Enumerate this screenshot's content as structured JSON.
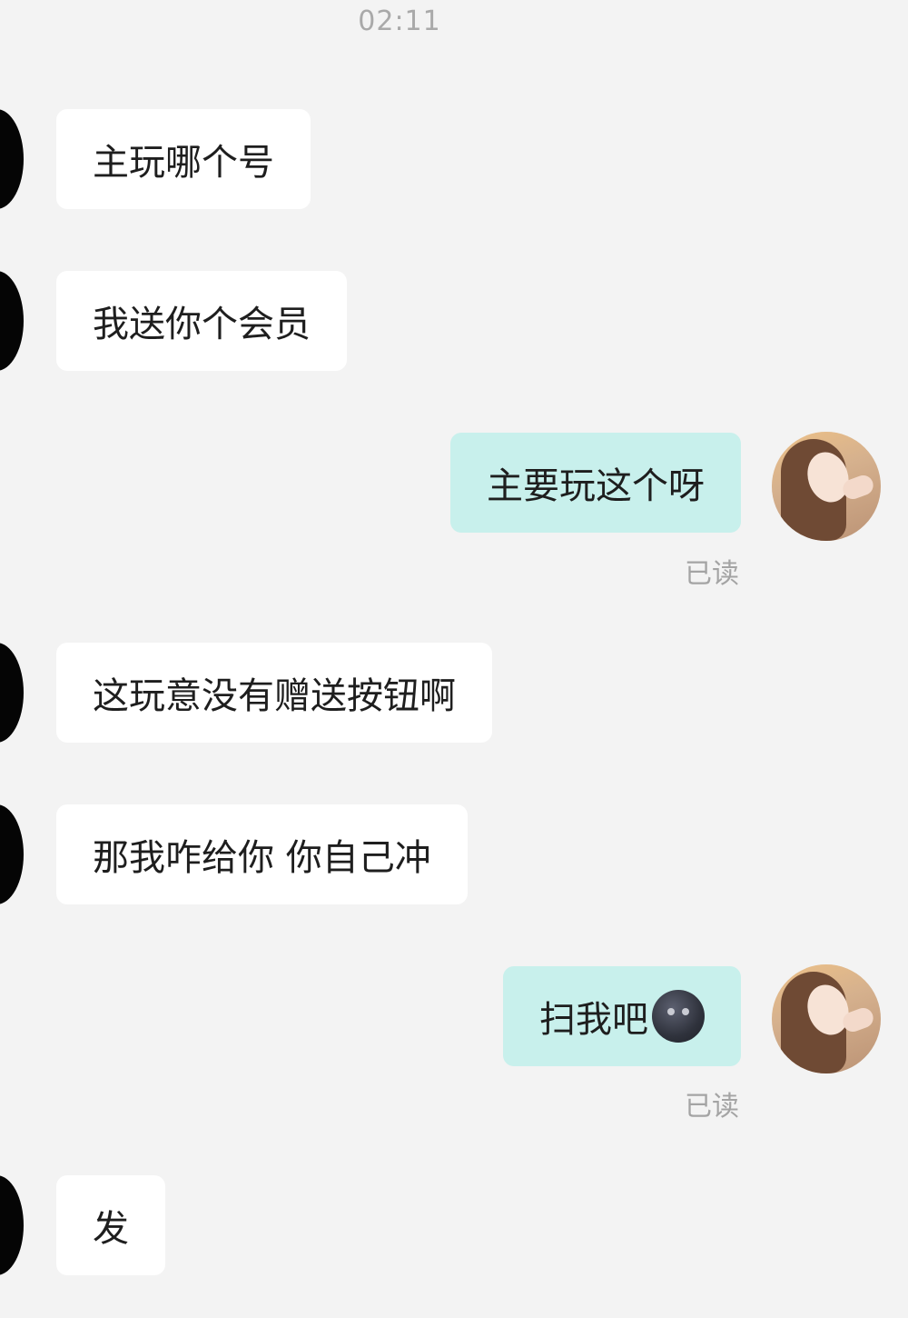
{
  "chat": {
    "timestamp": "02:11",
    "read_label": "已读",
    "messages": [
      {
        "direction": "incoming",
        "text": "主玩哪个号"
      },
      {
        "direction": "incoming",
        "text": "我送你个会员"
      },
      {
        "direction": "outgoing",
        "text": "主要玩这个呀",
        "status": "已读"
      },
      {
        "direction": "incoming",
        "text": "这玩意没有赠送按钮啊"
      },
      {
        "direction": "incoming",
        "text": "那我咋给你 你自己冲"
      },
      {
        "direction": "outgoing",
        "text": "扫我吧",
        "emoji": "new-moon-face-emoji",
        "status": "已读"
      },
      {
        "direction": "incoming",
        "text": "发"
      }
    ]
  },
  "colors": {
    "background": "#f3f3f3",
    "incoming_bubble": "#ffffff",
    "outgoing_bubble": "#c8f0ec",
    "text": "#1e1e1e",
    "meta_text": "#a4a4a4"
  },
  "icons": {
    "contact_avatar": "contact-avatar-icon",
    "user_avatar": "user-avatar-icon"
  }
}
